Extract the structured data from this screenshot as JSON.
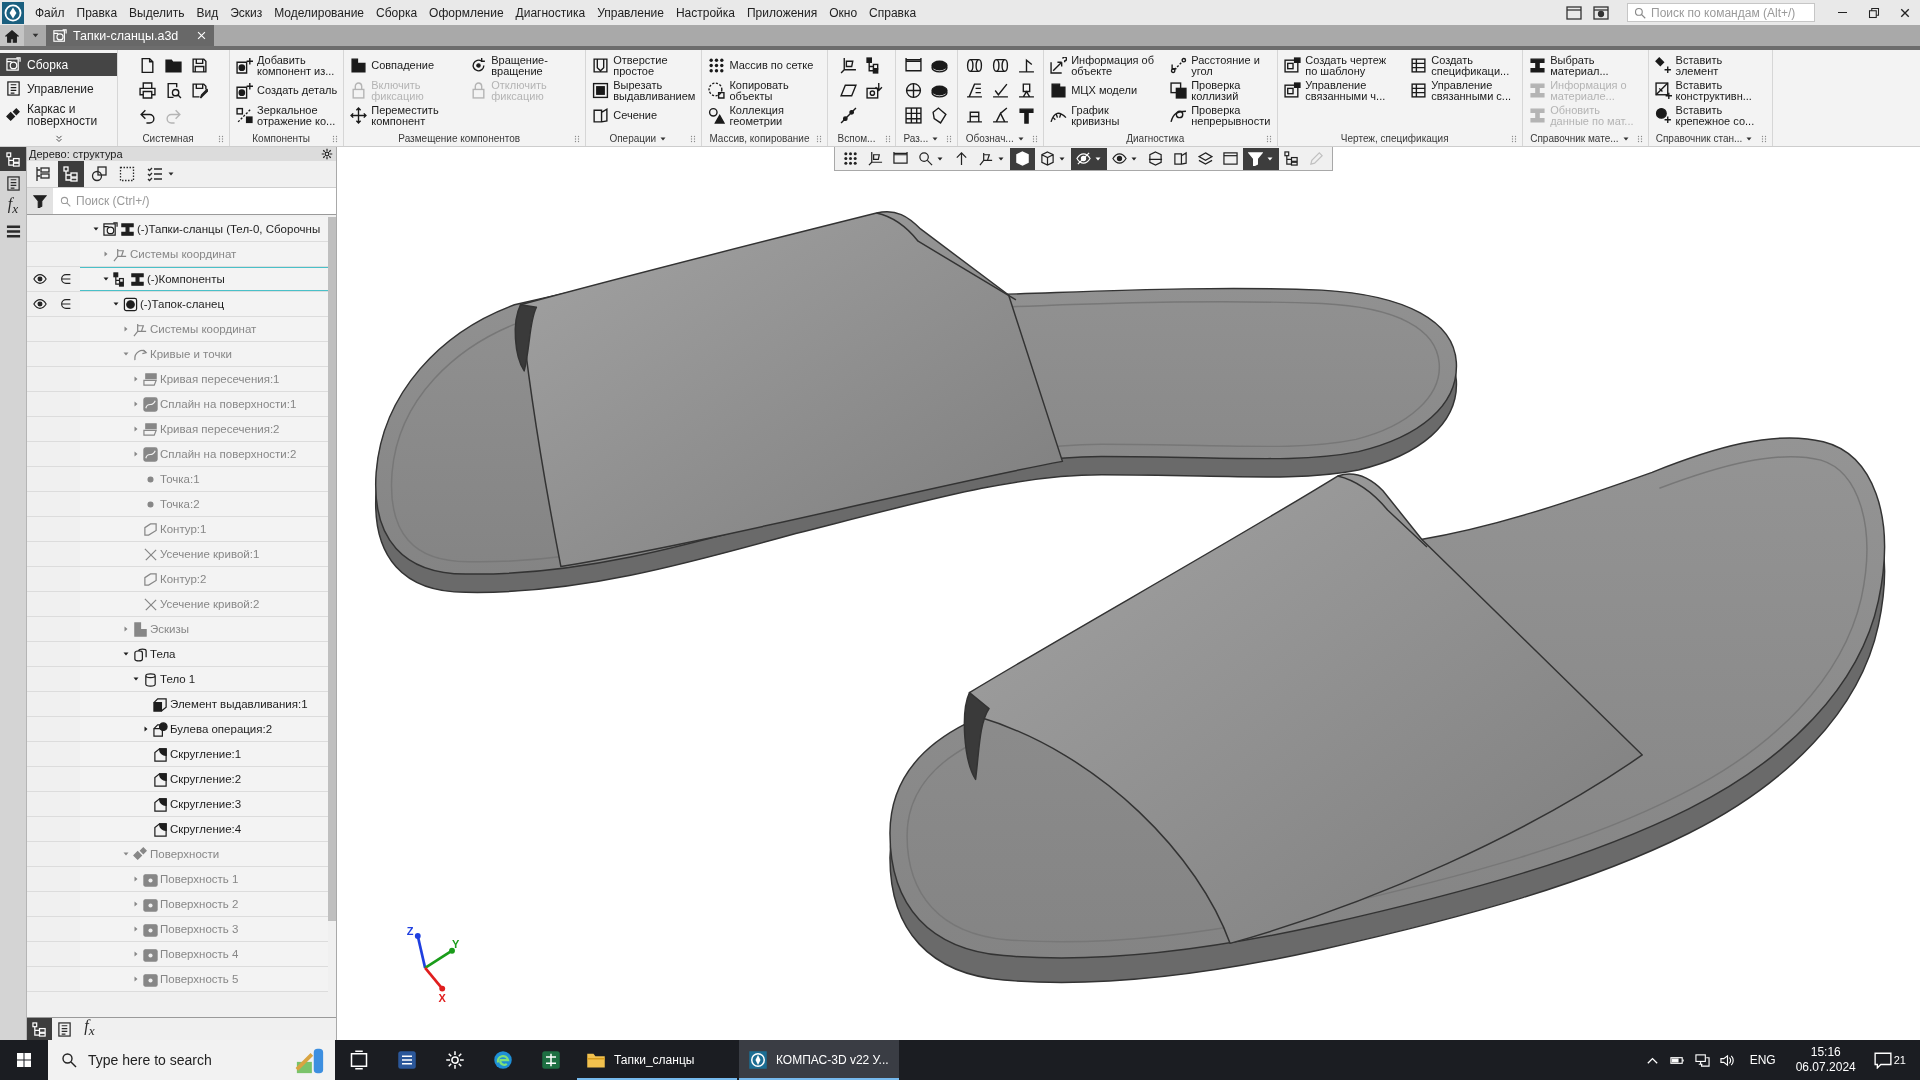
{
  "menu_bar": {
    "items": [
      "Файл",
      "Правка",
      "Выделить",
      "Вид",
      "Эскиз",
      "Моделирование",
      "Сборка",
      "Оформление",
      "Диагностика",
      "Управление",
      "Настройка",
      "Приложения",
      "Окно",
      "Справка"
    ],
    "search": {
      "placeholder": "Поиск по командам (Alt+/)"
    }
  },
  "document_tabs": [
    {
      "label": "Тапки-сланцы.a3d",
      "selected": true
    }
  ],
  "ribbon": {
    "tabs": [
      {
        "label": "Сборка",
        "kind": "assembly",
        "selected": true
      },
      {
        "label": "Управление",
        "kind": "management",
        "selected": false
      },
      {
        "label": "Каркас и\nповерхности",
        "kind": "surfaces",
        "selected": false
      }
    ],
    "groups": [
      {
        "label": "Системная",
        "menu": false,
        "buttons": [
          {
            "kind": "new",
            "disabled": false
          },
          {
            "kind": "open",
            "disabled": false
          },
          {
            "kind": "save",
            "disabled": false
          },
          {
            "kind": "print",
            "disabled": false
          },
          {
            "kind": "preview",
            "disabled": false
          },
          {
            "kind": "save-as",
            "disabled": false
          },
          {
            "kind": "undo",
            "disabled": false
          },
          {
            "kind": "redo",
            "disabled": true
          }
        ]
      },
      {
        "label": "Компоненты",
        "menu": false,
        "buttons": [
          {
            "label": "Добавить\nкомпонент из...",
            "kind": "add-component",
            "disabled": false
          },
          {
            "label": "Создать деталь",
            "kind": "create-part",
            "disabled": false
          },
          {
            "label": "Зеркальное\nотражение ко...",
            "kind": "mirror",
            "disabled": false
          }
        ]
      },
      {
        "label": "Размещение компонентов",
        "menu": false,
        "buttons": [
          {
            "label": "Совпадение",
            "kind": "coincide",
            "disabled": false
          },
          {
            "label": "Вращение-\nвращение",
            "kind": "rotate",
            "disabled": false
          },
          {
            "label": "Включить\nфиксацию",
            "kind": "fix",
            "disabled": true
          },
          {
            "label": "Отключить\nфиксацию",
            "kind": "unfix",
            "disabled": true
          },
          {
            "label": "Переместить\nкомпонент",
            "kind": "move",
            "disabled": false
          }
        ]
      },
      {
        "label": "Операции",
        "menu": true,
        "buttons": [
          {
            "label": "Отверстие\nпростое",
            "kind": "hole",
            "disabled": false
          },
          {
            "label": "Вырезать\nвыдавливанием",
            "kind": "cut",
            "disabled": false
          },
          {
            "label": "Сечение",
            "kind": "section",
            "disabled": false
          }
        ]
      },
      {
        "label": "Массив, копирование",
        "menu": false,
        "buttons": [
          {
            "label": "Массив по сетке",
            "kind": "array",
            "disabled": false
          },
          {
            "label": "Копировать\nобъекты",
            "kind": "copy",
            "disabled": false
          },
          {
            "label": "Коллекция\nгеометрии",
            "kind": "collection",
            "disabled": false
          }
        ]
      },
      {
        "label": "Вспом...",
        "menu": false,
        "buttons": [
          {
            "kind": "axis",
            "disabled": false
          },
          {
            "kind": "points",
            "disabled": false
          },
          {
            "kind": "plane",
            "disabled": false
          },
          {
            "kind": "view",
            "disabled": false
          },
          {
            "kind": "line",
            "disabled": false
          }
        ]
      },
      {
        "label": "Раз...",
        "menu": true,
        "buttons": [
          {
            "kind": "dimension",
            "disabled": false
          },
          {
            "kind": "radius",
            "disabled": false
          },
          {
            "kind": "angle",
            "disabled": false
          },
          {
            "kind": "diameter",
            "disabled": false
          },
          {
            "kind": "table",
            "disabled": false
          },
          {
            "kind": "auto",
            "disabled": false
          }
        ]
      },
      {
        "label": "Обознач...",
        "menu": true,
        "buttons": [
          {
            "kind": "thread",
            "disabled": false
          },
          {
            "kind": "cosmetic",
            "disabled": false
          },
          {
            "kind": "weld",
            "disabled": false
          },
          {
            "kind": "leader",
            "disabled": false
          },
          {
            "kind": "check",
            "disabled": false
          },
          {
            "kind": "datum",
            "disabled": false
          },
          {
            "kind": "base",
            "disabled": false
          },
          {
            "kind": "roughness",
            "disabled": false
          },
          {
            "kind": "text",
            "disabled": false
          }
        ]
      },
      {
        "label": "Диагностика",
        "menu": false,
        "buttons": [
          {
            "label": "Информация об\nобъекте",
            "kind": "info",
            "disabled": false
          },
          {
            "label": "Расстояние и\nугол",
            "kind": "distance",
            "disabled": false
          },
          {
            "label": "МЦХ модели",
            "kind": "mass",
            "disabled": false
          },
          {
            "label": "Проверка\nколлизий",
            "kind": "collision",
            "disabled": false
          },
          {
            "label": "График\nкривизны",
            "kind": "curvature",
            "disabled": false
          },
          {
            "label": "Проверка\nнепрерывности",
            "kind": "continuity",
            "disabled": false
          }
        ]
      },
      {
        "label": "Чертеж, спецификация",
        "menu": false,
        "buttons": [
          {
            "label": "Создать чертеж\nпо шаблону",
            "kind": "drawing",
            "disabled": false
          },
          {
            "label": "Создать\nспецификаци...",
            "kind": "spec",
            "disabled": false
          },
          {
            "label": "Управление\nсвязанными ч...",
            "kind": "linked",
            "disabled": false
          },
          {
            "label": "Управление\nсвязанными с...",
            "kind": "linked-spec",
            "disabled": false
          }
        ]
      },
      {
        "label": "Справочник мате...",
        "menu": true,
        "buttons": [
          {
            "label": "Выбрать\nматериал...",
            "kind": "material",
            "disabled": false
          },
          {
            "label": "Информация о\nматериале...",
            "kind": "material-info",
            "disabled": true
          },
          {
            "label": "Обновить\nданные по мат...",
            "kind": "update",
            "disabled": true
          }
        ]
      },
      {
        "label": "Справочник стан...",
        "menu": true,
        "buttons": [
          {
            "label": "Вставить\nэлемент",
            "kind": "insert",
            "disabled": false
          },
          {
            "label": "Вставить\nконструктивн...",
            "kind": "insert-construct",
            "disabled": false
          },
          {
            "label": "Вставить\nкрепежное со...",
            "kind": "insert-fastener",
            "disabled": false
          }
        ]
      }
    ]
  },
  "side_strip": [
    {
      "kind": "structure",
      "selected": true
    },
    {
      "kind": "properties",
      "selected": false
    },
    {
      "kind": "formula",
      "label": "f$_{x}$",
      "selected": false
    },
    {
      "kind": "menu",
      "selected": false
    }
  ],
  "tree_panel": {
    "title": "Дерево: структура",
    "toolbar": [
      {
        "kind": "numbered",
        "selected": false,
        "menu": false
      },
      {
        "kind": "structure",
        "selected": true,
        "menu": false
      },
      {
        "kind": "parts",
        "selected": false,
        "menu": false
      },
      {
        "kind": "selection",
        "selected": false,
        "menu": false
      },
      {
        "kind": "checklist",
        "selected": false,
        "menu": true
      }
    ],
    "search": {
      "placeholder": "Поиск (Ctrl+/)"
    },
    "items": [
      {
        "label": "(-)Тапки-сланцы (Тел-0, Сборочны",
        "kind": "assembly",
        "expandable": true,
        "expanded": true,
        "dimmed": false,
        "selected": false,
        "eye": false,
        "children": [
          {
            "label": "Системы координат",
            "kind": "coords",
            "expandable": true,
            "expanded": false,
            "dimmed": true,
            "selected": false,
            "eye": false
          },
          {
            "label": "(-)Компоненты",
            "kind": "components",
            "expandable": true,
            "expanded": true,
            "dimmed": false,
            "selected": true,
            "eye": true,
            "children": [
              {
                "label": "(-)Тапок-сланец",
                "kind": "part",
                "expandable": true,
                "expanded": true,
                "dimmed": false,
                "selected": false,
                "eye": true,
                "children": [
                  {
                    "label": "Системы координат",
                    "kind": "coords",
                    "expandable": true,
                    "expanded": false,
                    "dimmed": true,
                    "selected": false,
                    "eye": false
                  },
                  {
                    "label": "Кривые и точки",
                    "kind": "curves",
                    "expandable": true,
                    "expanded": true,
                    "dimmed": true,
                    "selected": false,
                    "eye": false,
                    "children": [
                      {
                        "label": "Кривая пересечения:1",
                        "kind": "intersection-curve",
                        "expandable": true,
                        "expanded": false,
                        "dimmed": true,
                        "selected": false,
                        "eye": false
                      },
                      {
                        "label": "Сплайн на поверхности:1",
                        "kind": "spline",
                        "expandable": true,
                        "expanded": false,
                        "dimmed": true,
                        "selected": false,
                        "eye": false
                      },
                      {
                        "label": "Кривая пересечения:2",
                        "kind": "intersection-curve",
                        "expandable": true,
                        "expanded": false,
                        "dimmed": true,
                        "selected": false,
                        "eye": false
                      },
                      {
                        "label": "Сплайн на поверхности:2",
                        "kind": "spline",
                        "expandable": true,
                        "expanded": false,
                        "dimmed": true,
                        "selected": false,
                        "eye": false
                      },
                      {
                        "label": "Точка:1",
                        "kind": "point",
                        "expandable": false,
                        "dimmed": true,
                        "selected": false,
                        "eye": false
                      },
                      {
                        "label": "Точка:2",
                        "kind": "point",
                        "expandable": false,
                        "dimmed": true,
                        "selected": false,
                        "eye": false
                      },
                      {
                        "label": "Контур:1",
                        "kind": "contour",
                        "expandable": false,
                        "dimmed": true,
                        "selected": false,
                        "eye": false
                      },
                      {
                        "label": "Усечение кривой:1",
                        "kind": "trim",
                        "expandable": false,
                        "dimmed": true,
                        "selected": false,
                        "eye": false
                      },
                      {
                        "label": "Контур:2",
                        "kind": "contour",
                        "expandable": false,
                        "dimmed": true,
                        "selected": false,
                        "eye": false
                      },
                      {
                        "label": "Усечение кривой:2",
                        "kind": "trim",
                        "expandable": false,
                        "dimmed": true,
                        "selected": false,
                        "eye": false
                      }
                    ]
                  },
                  {
                    "label": "Эскизы",
                    "kind": "sketches",
                    "expandable": true,
                    "expanded": false,
                    "dimmed": true,
                    "selected": false,
                    "eye": false
                  },
                  {
                    "label": "Тела",
                    "kind": "bodies",
                    "expandable": true,
                    "expanded": true,
                    "dimmed": false,
                    "selected": false,
                    "eye": false,
                    "children": [
                      {
                        "label": "Тело 1",
                        "kind": "body",
                        "expandable": true,
                        "expanded": true,
                        "dimmed": false,
                        "selected": false,
                        "eye": false,
                        "children": [
                          {
                            "label": "Элемент выдавливания:1",
                            "kind": "extrusion",
                            "expandable": false,
                            "dimmed": false,
                            "selected": false,
                            "eye": false
                          },
                          {
                            "label": "Булева операция:2",
                            "kind": "boolean",
                            "expandable": true,
                            "expanded": false,
                            "dimmed": false,
                            "selected": false,
                            "eye": false
                          },
                          {
                            "label": "Скругление:1",
                            "kind": "fillet",
                            "expandable": false,
                            "dimmed": false,
                            "selected": false,
                            "eye": false
                          },
                          {
                            "label": "Скругление:2",
                            "kind": "fillet",
                            "expandable": false,
                            "dimmed": false,
                            "selected": false,
                            "eye": false
                          },
                          {
                            "label": "Скругление:3",
                            "kind": "fillet",
                            "expandable": false,
                            "dimmed": false,
                            "selected": false,
                            "eye": false
                          },
                          {
                            "label": "Скругление:4",
                            "kind": "fillet",
                            "expandable": false,
                            "dimmed": false,
                            "selected": false,
                            "eye": false
                          }
                        ]
                      }
                    ]
                  },
                  {
                    "label": "Поверхности",
                    "kind": "surfaces",
                    "expandable": true,
                    "expanded": true,
                    "dimmed": true,
                    "selected": false,
                    "eye": false,
                    "children": [
                      {
                        "label": "Поверхность 1",
                        "kind": "surface",
                        "expandable": true,
                        "expanded": false,
                        "dimmed": true,
                        "selected": false,
                        "eye": false
                      },
                      {
                        "label": "Поверхность 2",
                        "kind": "surface",
                        "expandable": true,
                        "expanded": false,
                        "dimmed": true,
                        "selected": false,
                        "eye": false
                      },
                      {
                        "label": "Поверхность 3",
                        "kind": "surface",
                        "expandable": true,
                        "expanded": false,
                        "dimmed": true,
                        "selected": false,
                        "eye": false
                      },
                      {
                        "label": "Поверхность 4",
                        "kind": "surface",
                        "expandable": true,
                        "expanded": false,
                        "dimmed": true,
                        "selected": false,
                        "eye": false
                      },
                      {
                        "label": "Поверхность 5",
                        "kind": "surface",
                        "expandable": true,
                        "expanded": false,
                        "dimmed": true,
                        "selected": false,
                        "eye": false
                      }
                    ]
                  }
                ]
              }
            ]
          }
        ]
      }
    ],
    "bottom_tabs": [
      {
        "kind": "structure",
        "selected": true
      },
      {
        "kind": "properties",
        "selected": false
      },
      {
        "kind": "formula",
        "label": "f$_{x}$",
        "selected": false
      }
    ]
  },
  "view_toolbar": [
    {
      "kind": "grid",
      "on": false,
      "menu": false,
      "disabled": false
    },
    {
      "kind": "sketch",
      "on": false,
      "menu": false,
      "disabled": false
    },
    {
      "kind": "measure",
      "on": false,
      "menu": false,
      "disabled": false
    },
    {
      "kind": "zoom",
      "on": false,
      "menu": true,
      "disabled": false
    },
    {
      "kind": "orient",
      "on": false,
      "menu": false,
      "disabled": false
    },
    {
      "kind": "orientation",
      "on": false,
      "menu": true,
      "disabled": false
    },
    {
      "kind": "shaded",
      "on": true,
      "menu": false,
      "disabled": false
    },
    {
      "kind": "wireframe",
      "on": false,
      "menu": true,
      "disabled": false
    },
    {
      "kind": "hide",
      "on": true,
      "menu": true,
      "disabled": false
    },
    {
      "kind": "display",
      "on": false,
      "menu": true,
      "disabled": false
    },
    {
      "kind": "clip",
      "on": false,
      "menu": false,
      "disabled": false
    },
    {
      "kind": "section",
      "on": false,
      "menu": false,
      "disabled": false
    },
    {
      "kind": "layers",
      "on": false,
      "menu": false,
      "disabled": false
    },
    {
      "kind": "views",
      "on": false,
      "menu": false,
      "disabled": false
    },
    {
      "kind": "filter",
      "on": true,
      "menu": true,
      "disabled": false
    },
    {
      "kind": "structure",
      "on": false,
      "menu": false,
      "disabled": false
    },
    {
      "kind": "edit",
      "on": false,
      "menu": false,
      "disabled": true
    }
  ],
  "axes": [
    {
      "label": "Z",
      "color": "#1f3fe0"
    },
    {
      "label": "Y",
      "color": "#1a9c1a"
    },
    {
      "label": "X",
      "color": "#e01e1e"
    }
  ],
  "taskbar": {
    "search": {
      "placeholder": "Type here to search"
    },
    "apps": [
      {
        "kind": "task-view",
        "running": false,
        "selected": false
      },
      {
        "kind": "word",
        "running": false,
        "selected": false
      },
      {
        "kind": "settings",
        "running": false,
        "selected": false
      },
      {
        "kind": "edge",
        "running": false,
        "selected": false
      },
      {
        "kind": "excel",
        "running": false,
        "selected": false
      },
      {
        "kind": "explorer",
        "label": "Тапки_сланцы",
        "running": true,
        "selected": false
      },
      {
        "kind": "kompas",
        "label": "КОМПАС-3D v22 У...",
        "running": true,
        "selected": true
      }
    ],
    "tray": {
      "language": "ENG",
      "time": "15:16",
      "date": "06.07.2024",
      "notifications": "21"
    }
  }
}
